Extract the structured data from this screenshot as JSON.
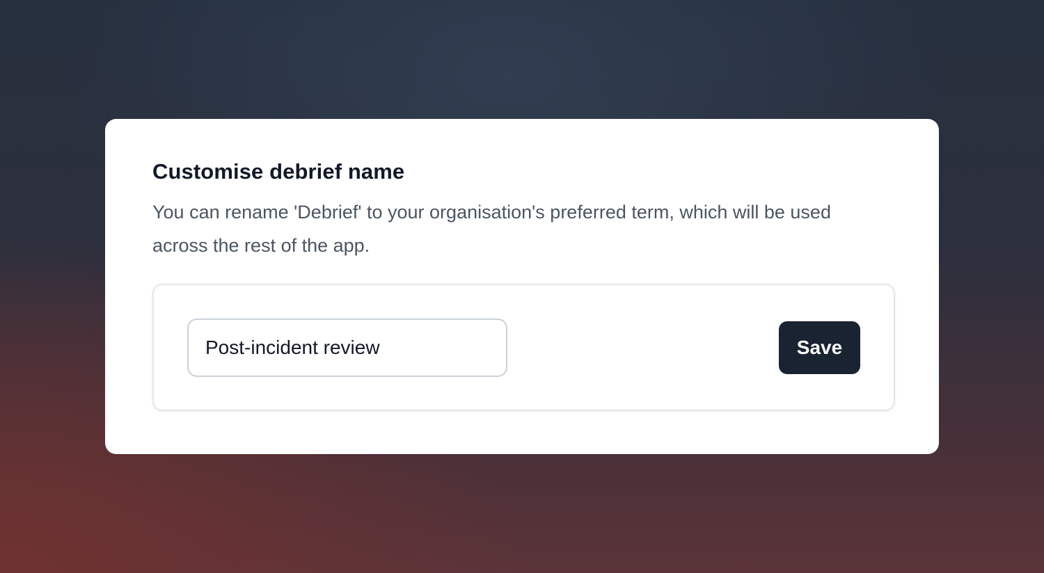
{
  "card": {
    "title": "Customise debrief name",
    "description": "You can rename 'Debrief' to your organisation's preferred term, which will be used across the rest of the app."
  },
  "form": {
    "name_value": "Post-incident review",
    "save_label": "Save"
  },
  "colors": {
    "primary_button": "#1a2332",
    "title_text": "#111827",
    "body_text": "#4b5563"
  }
}
